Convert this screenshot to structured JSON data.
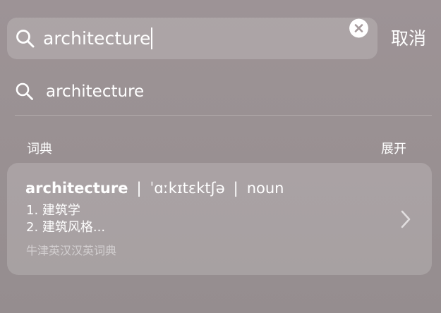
{
  "search": {
    "value": "architecture",
    "cancel_label": "取消",
    "icons": {
      "search": "search-icon",
      "clear": "clear-circle-icon"
    }
  },
  "suggestion": {
    "text": "architecture",
    "icon": "search-icon"
  },
  "dictionary_section": {
    "title": "词典",
    "expand_label": "展开",
    "entry": {
      "word": "architecture",
      "separator": "|",
      "phonetic": "ˈɑːkɪtɛktʃə",
      "part_of_speech": "noun",
      "definitions": [
        "1. 建筑学",
        "2. 建筑风格..."
      ],
      "source": "牛津英汉汉英词典",
      "chevron": "chevron-right-icon"
    }
  },
  "colors": {
    "background": "#9a9193",
    "text": "#ffffff",
    "muted_text": "rgba(255,255,255,0.5)",
    "panel": "rgba(255,255,255,0.17)"
  }
}
